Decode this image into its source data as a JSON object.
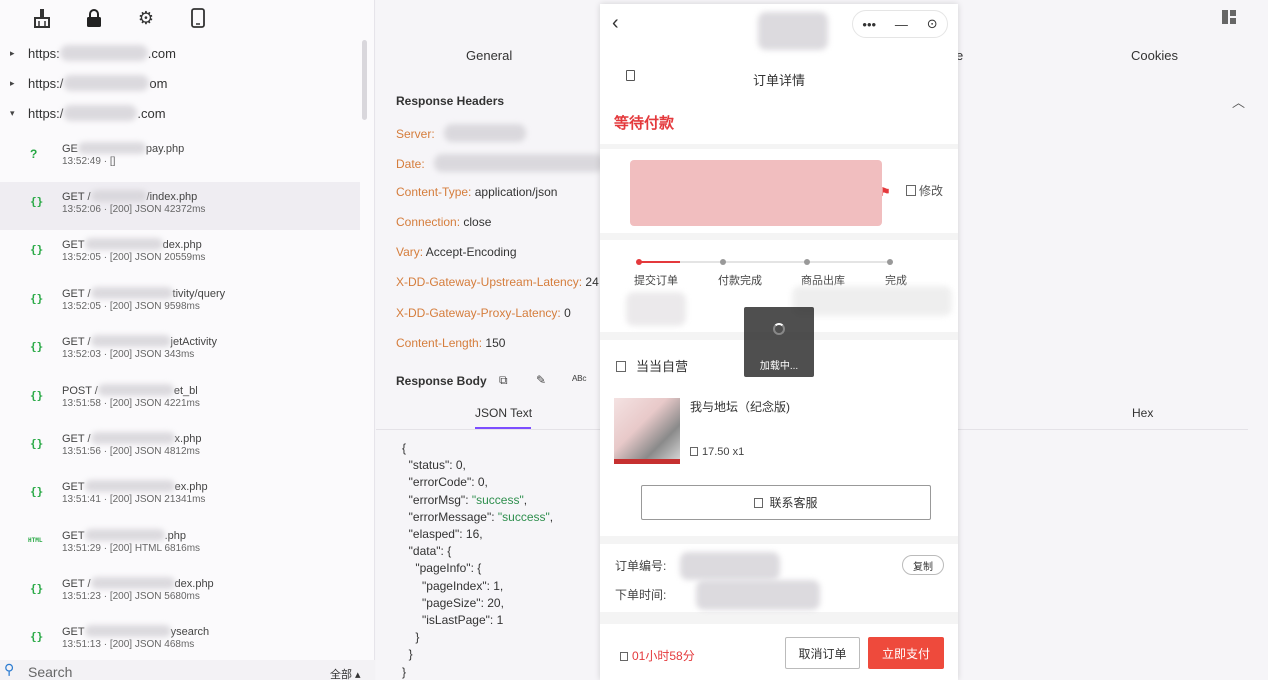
{
  "toolbar": {
    "icons": [
      "broom-icon",
      "lock-icon",
      "gear-icon",
      "phone-icon"
    ]
  },
  "domains": [
    {
      "prefix": "https:",
      "suffix": ".com",
      "expanded": false
    },
    {
      "prefix": "https:/",
      "suffix": "om",
      "expanded": false
    },
    {
      "prefix": "https:/",
      "suffix": ".com",
      "expanded": true
    }
  ],
  "requests": [
    {
      "icon": "?",
      "line1": "GE",
      "path": "pay.php",
      "line2": "13:52:49 · []"
    },
    {
      "icon": "{}",
      "line1": "GET /",
      "path": "/index.php",
      "line2": "13:52:06 · [200] JSON 42372ms"
    },
    {
      "icon": "{}",
      "line1": "GET",
      "path": "dex.php",
      "line2": "13:52:05 · [200] JSON 20559ms"
    },
    {
      "icon": "{}",
      "line1": "GET /",
      "path": "tivity/query",
      "line2": "13:52:05 · [200] JSON 9598ms"
    },
    {
      "icon": "{}",
      "line1": "GET /",
      "path": "jetActivity",
      "line2": "13:52:03 · [200] JSON 343ms"
    },
    {
      "icon": "{}",
      "line1": "POST /",
      "path": "et_bl",
      "line2": "13:51:58 · [200] JSON 4221ms"
    },
    {
      "icon": "{}",
      "line1": "GET /",
      "path": "x.php",
      "line2": "13:51:56 · [200] JSON 4812ms"
    },
    {
      "icon": "{}",
      "line1": "GET",
      "path": "ex.php",
      "line2": "13:51:41 · [200] JSON 21341ms"
    },
    {
      "icon": "HTML",
      "line1": "GET",
      "path": ".php",
      "line2": "13:51:29 · [200] HTML 6816ms"
    },
    {
      "icon": "{}",
      "line1": "GET /",
      "path": "dex.php",
      "line2": "13:51:23 · [200] JSON 5680ms"
    },
    {
      "icon": "{}",
      "line1": "GET",
      "path": "ysearch",
      "line2": "13:51:13 · [200] JSON 468ms"
    }
  ],
  "search": {
    "placeholder": "Search",
    "scope": "全部 ▴"
  },
  "tabs": {
    "general": "General",
    "fourth": "e",
    "cookies": "Cookies"
  },
  "response_headers": {
    "title": "Response Headers",
    "items": [
      {
        "key": "Server:",
        "value": ""
      },
      {
        "key": "Date:",
        "value": ""
      },
      {
        "key": "Content-Type:",
        "value": "application/json"
      },
      {
        "key": "Connection:",
        "value": "close"
      },
      {
        "key": "Vary:",
        "value": "Accept-Encoding"
      },
      {
        "key": "X-DD-Gateway-Upstream-Latency:",
        "value": "24"
      },
      {
        "key": "X-DD-Gateway-Proxy-Latency:",
        "value": "0"
      },
      {
        "key": "Content-Length:",
        "value": "150"
      }
    ]
  },
  "response_body": {
    "title": "Response Body",
    "tools": [
      "copy-icon",
      "edit-doc-icon",
      "abc-icon"
    ],
    "tools_text": [
      "⧉",
      "✎",
      "ᴬᴮᶜ"
    ],
    "subtabs": {
      "json": "JSON Text",
      "hex": "Hex"
    },
    "json_lines": [
      "{",
      "  \"status\": 0,",
      "  \"errorCode\": 0,",
      "  \"errorMsg\": \"success\",",
      "  \"errorMessage\": \"success\",",
      "  \"elasped\": 16,",
      "  \"data\": {",
      "    \"pageInfo\": {",
      "      \"pageIndex\": 1,",
      "      \"pageSize\": 20,",
      "      \"isLastPage\": 1",
      "    }",
      "  }",
      "}"
    ]
  },
  "phone": {
    "capsule": [
      "•••",
      "—",
      "⊙"
    ],
    "page_title": "订单详情",
    "status": "等待付款",
    "edit": "修改",
    "steps": [
      "提交订单",
      "付款完成",
      "商品出库",
      "完成"
    ],
    "loading": "加载中...",
    "shop": "当当自营",
    "book_name": "我与地坛（纪念版)",
    "book_price": "17.50 x1",
    "service_button": "联系客服",
    "order_no_label": "订单编号:",
    "order_time_label": "下单时间:",
    "copy_button": "复制",
    "timer": "01小时58分",
    "cancel_button": "取消订单",
    "pay_button": "立即支付",
    "accent_color": "#e4393c"
  }
}
